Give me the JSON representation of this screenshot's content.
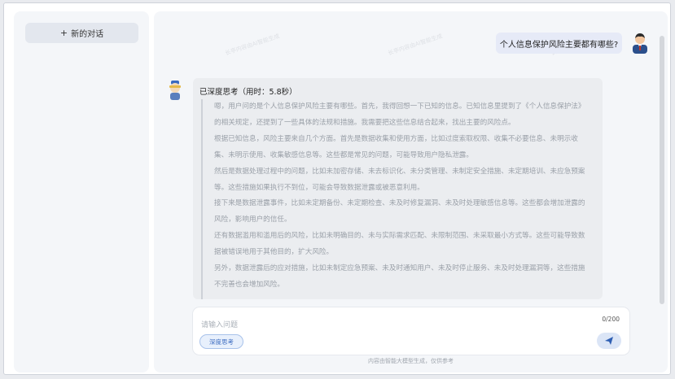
{
  "sidebar": {
    "new_chat_label": "新的对话",
    "new_chat_icon": "plus-icon"
  },
  "conversation": {
    "user_message": "个人信息保护风险主要都有哪些?",
    "think_title": "已深度思考（用时：5.8秒）",
    "paragraphs": [
      "嗯，用户问的是个人信息保护风险主要有哪些。首先，我得回想一下已知的信息。已知信息里提到了《个人信息保护法》的相关规定，还提到了一些具体的法规和措施。我需要把这些信息结合起来，找出主要的风险点。",
      "根据已知信息，风险主要来自几个方面。首先是数据收集和使用方面，比如过度索取权限、收集不必要信息、未明示收集、未明示使用、收集敏感信息等。这些都是常见的问题，可能导致用户隐私泄露。",
      "然后是数据处理过程中的问题，比如未加密存储、未去标识化、未分类管理、未制定安全措施、未定期培训、未应急预案等。这些措施如果执行不到位，可能会导致数据泄露或被恶意利用。",
      "接下来是数据泄露事件，比如未定期备份、未定期检查、未及时修复漏洞、未及时处理敏感信息等。这些都会增加泄露的风险，影响用户的信任。",
      "还有数据滥用和滥用后的风险，比如未明确目的、未与实际需求匹配、未限制范围、未采取最小方式等。这些可能导致数据被错误地用于其他目的，扩大风险。",
      "另外，数据泄露后的应对措施，比如未制定应急预案、未及时通知用户、未及时停止服务、未及时处理漏洞等，这些措施不完善也会增加风险。"
    ],
    "watermark": "长亭内容由AI智能生成"
  },
  "input": {
    "placeholder": "请输入问题",
    "counter": "0/200",
    "deep_think_label": "深度思考",
    "send_icon": "send-icon"
  },
  "footer_note": "内容由智能大模型生成，仅供参考",
  "colors": {
    "accent": "#3b6bc0",
    "user_bubble": "#e6eaf7",
    "panel": "#f4f6f9"
  }
}
